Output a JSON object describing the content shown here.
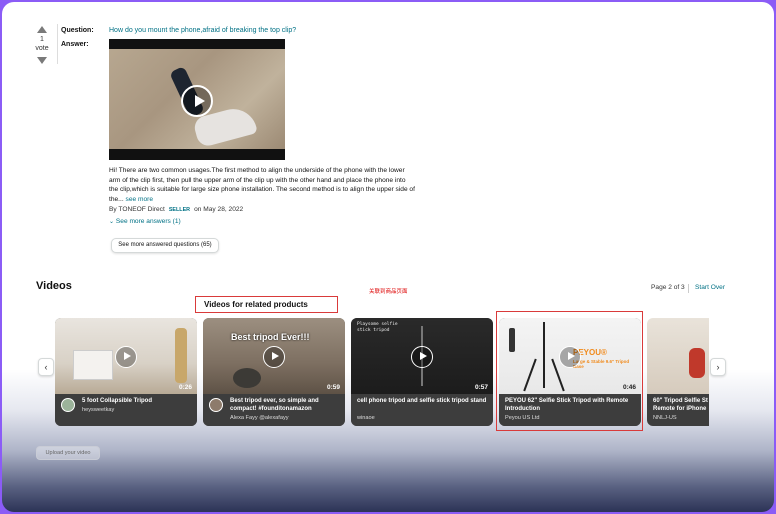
{
  "qa": {
    "vote_count": "1",
    "vote_label": "vote",
    "question_label": "Question:",
    "answer_label": "Answer:",
    "question_text": "How do you mount the phone,afraid of breaking the top clip?",
    "answer_text": "Hi! There are two common usages.The first method to align the underside of the phone with the lower arm of the clip first, then pull the upper arm of the clip up with the other hand and place the phone into the clip,which is suitable for large size phone installation. The second method is to align the upper side of the...",
    "see_more": "see more",
    "byline_prefix": "By TONEOF Direct",
    "seller_badge": "SELLER",
    "byline_date": "on May 28, 2022",
    "see_more_answers": "See more answers (1)",
    "see_more_questions_button": "See more answered questions (65)"
  },
  "videos": {
    "title": "Videos",
    "related_title": "Videos for related products",
    "red_note": "关联到商品页面",
    "pager_text": "Page 2 of 3",
    "start_over": "Start Over",
    "prev_arrow": "‹",
    "next_arrow": "›",
    "cards": [
      {
        "title": "5 foot Collapsible Tripod",
        "author": "heysweetkay",
        "duration": "0:26",
        "overlay": ""
      },
      {
        "title": "Best tripod ever, so simple and compact! #founditonamazon",
        "author": "Alexa Fayy @alexafayy",
        "duration": "0:59",
        "overlay": "Best tripod Ever!!!"
      },
      {
        "title": "cell phone tripod and selfie stick tripod stand",
        "author": "winaoe",
        "duration": "0:57",
        "overlay": "Playsome selfie stick tripod"
      },
      {
        "title": "PEYOU 62\" Selfie Stick Tripod with Remote Introduction",
        "author": "Peyou US Ltd",
        "duration": "0:46",
        "overlay": "PEYOU®",
        "overlay_sub": "Large & Stable 9.6\" Tripod Base"
      },
      {
        "title": "60\" Tripod Selfie St Remote for iPhone",
        "author": "NNLJ-US",
        "duration": "",
        "overlay": ""
      }
    ],
    "upload_button": "Upload your video"
  },
  "colors": {
    "link": "#007185",
    "highlight": "#d93a3a",
    "frame": "#8b5cf6"
  }
}
